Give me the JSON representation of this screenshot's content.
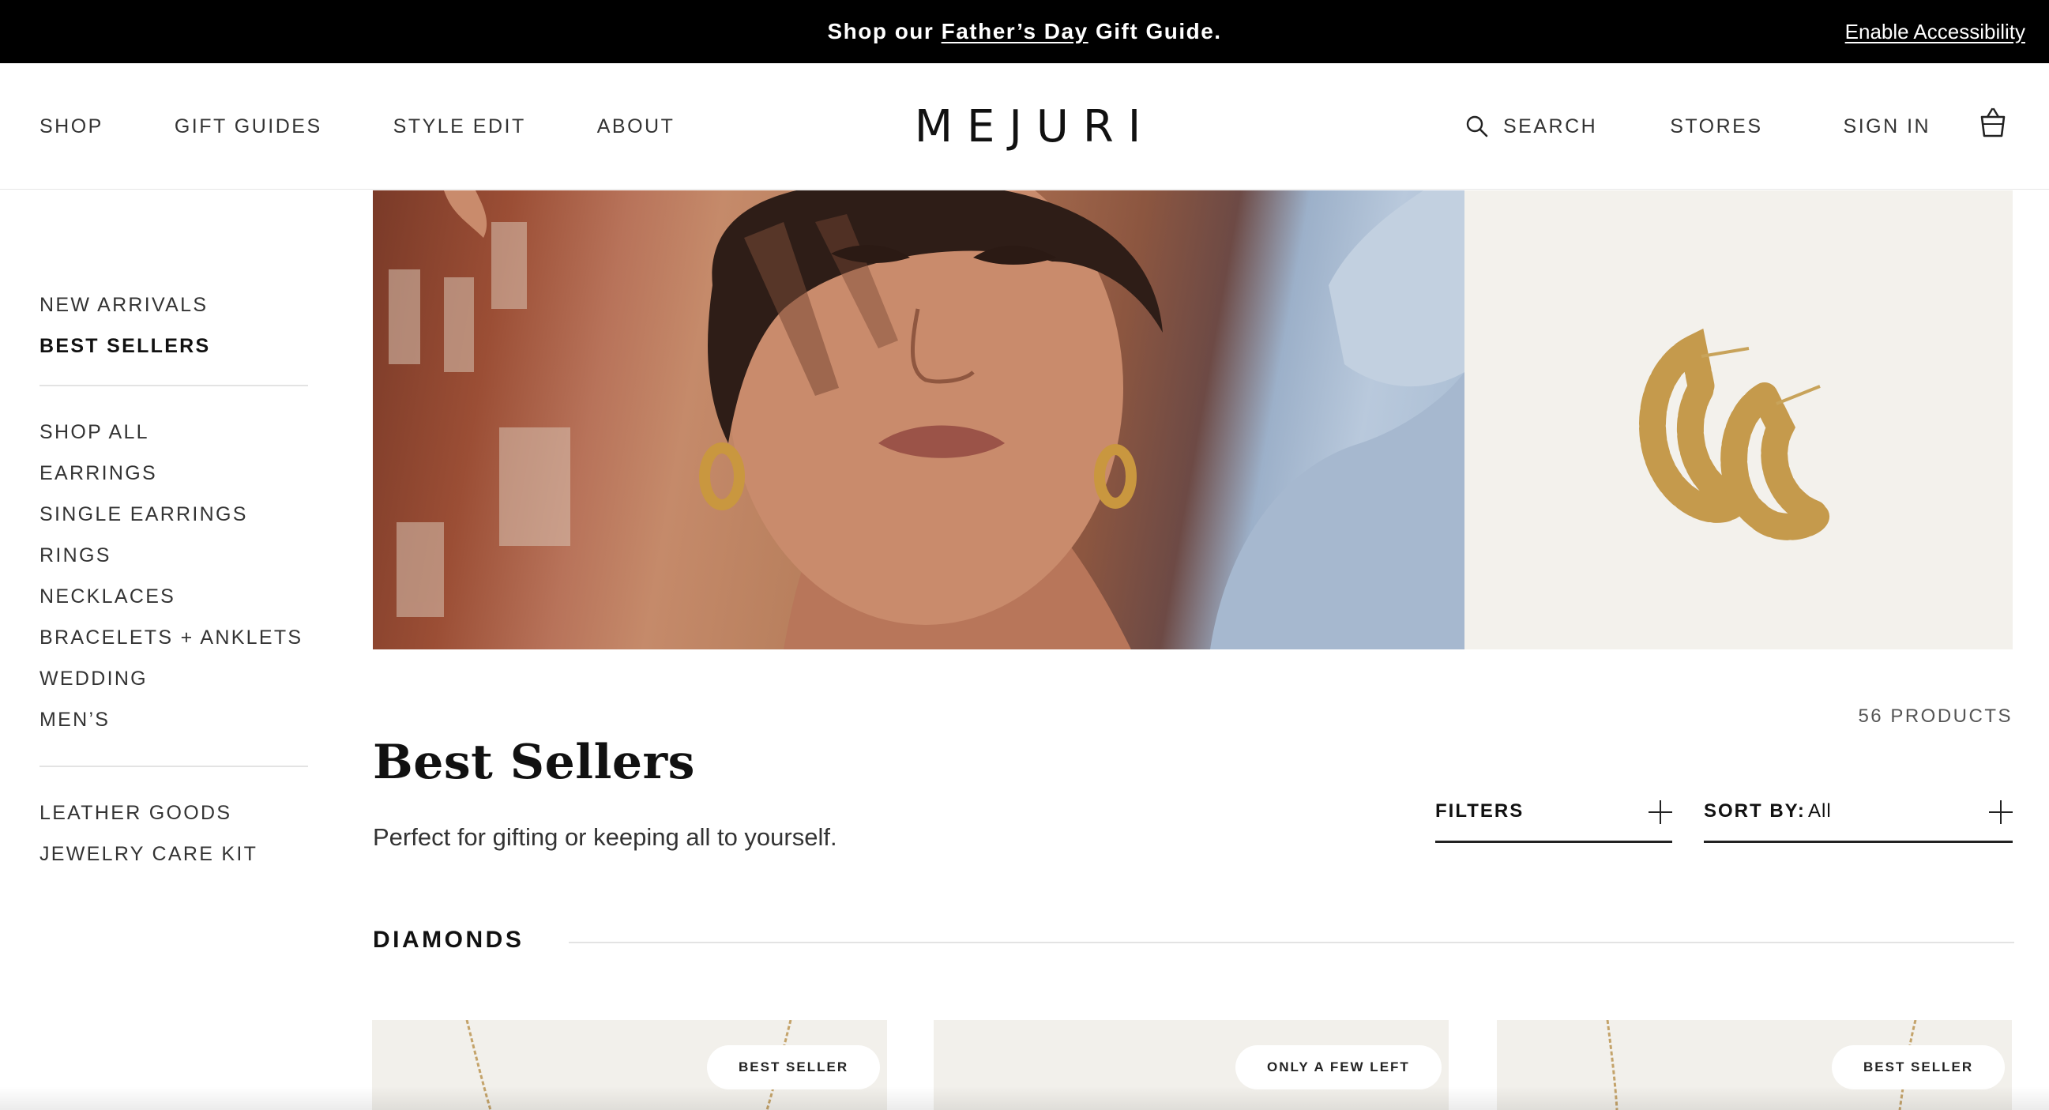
{
  "announcement": {
    "prefix": "Shop our ",
    "link": "Father’s Day",
    "suffix": " Gift Guide.",
    "accessibility": "Enable Accessibility"
  },
  "header": {
    "nav_left": [
      "SHOP",
      "GIFT GUIDES",
      "STYLE EDIT",
      "ABOUT"
    ],
    "logo": "MEJURI",
    "search": "SEARCH",
    "stores": "STORES",
    "sign_in": "SIGN IN",
    "icons": {
      "search": "search-icon",
      "cart": "shopping-bag-icon"
    }
  },
  "sidebar": {
    "group1": [
      "NEW ARRIVALS",
      "BEST SELLERS"
    ],
    "active": "BEST SELLERS",
    "group2": [
      "SHOP ALL",
      "EARRINGS",
      "SINGLE EARRINGS",
      "RINGS",
      "NECKLACES",
      "BRACELETS + ANKLETS",
      "WEDDING",
      "MEN’S"
    ],
    "group3": [
      "LEATHER GOODS",
      "JEWELRY CARE KIT"
    ]
  },
  "page": {
    "count": "56 PRODUCTS",
    "title": "Best Sellers",
    "subtitle": "Perfect for gifting or keeping all to yourself.",
    "filters_label": "FILTERS",
    "sort_label": "SORT BY:",
    "sort_value": "All"
  },
  "section": {
    "label": "DIAMONDS",
    "cards": [
      {
        "badge": "BEST SELLER"
      },
      {
        "badge": "ONLY A FEW LEFT"
      },
      {
        "badge": "BEST SELLER"
      }
    ]
  },
  "colors": {
    "announcement_bg": "#000000",
    "text": "#1d1d1d",
    "card_bg": "#f2f0eb"
  }
}
